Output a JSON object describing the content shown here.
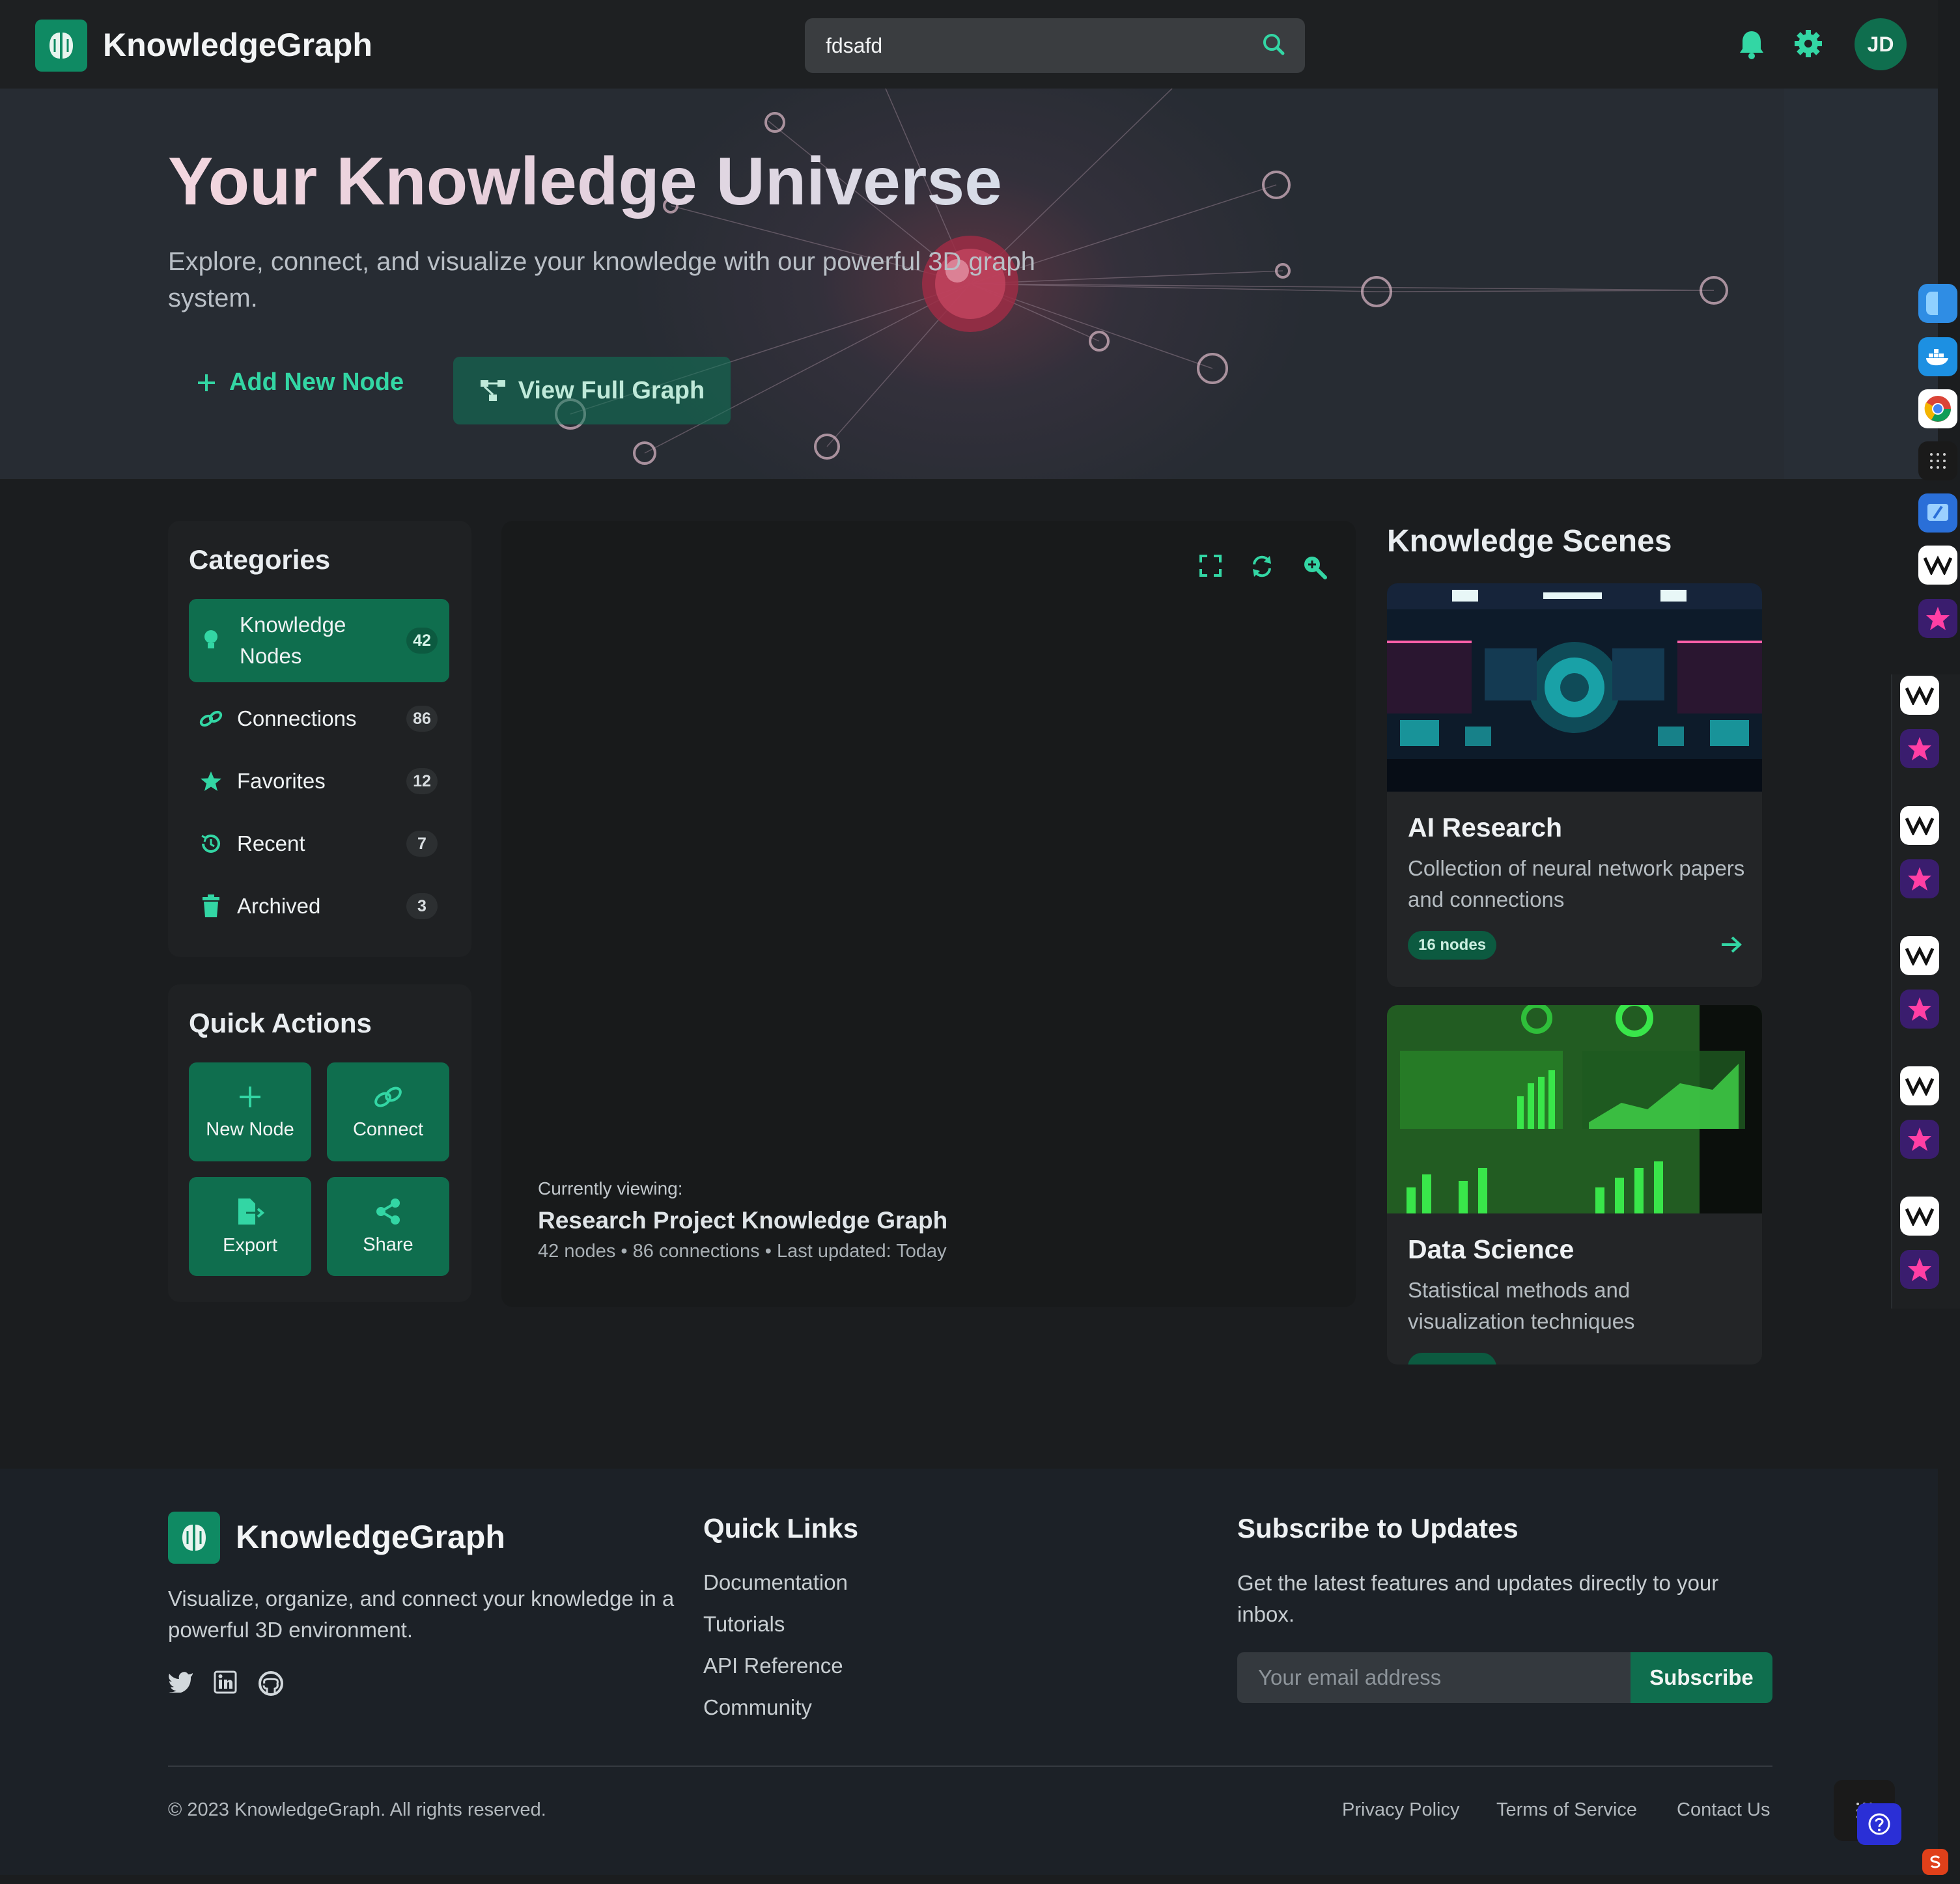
{
  "header": {
    "brand": "KnowledgeGraph",
    "search_value": "fdsafd",
    "avatar_initials": "JD"
  },
  "hero": {
    "title": "Your Knowledge Universe",
    "subtitle": "Explore, connect, and visualize your knowledge with our powerful 3D graph system.",
    "add_node_label": "Add New Node",
    "view_graph_label": "View Full Graph"
  },
  "categories": {
    "title": "Categories",
    "items": [
      {
        "label": "Knowledge Nodes",
        "count": "42",
        "icon": "lightbulb-icon"
      },
      {
        "label": "Connections",
        "count": "86",
        "icon": "link-icon"
      },
      {
        "label": "Favorites",
        "count": "12",
        "icon": "star-icon"
      },
      {
        "label": "Recent",
        "count": "7",
        "icon": "history-icon"
      },
      {
        "label": "Archived",
        "count": "3",
        "icon": "trash-icon"
      }
    ]
  },
  "quick_actions": {
    "title": "Quick Actions",
    "items": [
      {
        "label": "New Node",
        "icon": "plus-icon"
      },
      {
        "label": "Connect",
        "icon": "link-icon"
      },
      {
        "label": "Export",
        "icon": "export-icon"
      },
      {
        "label": "Share",
        "icon": "share-icon"
      }
    ]
  },
  "graph": {
    "currently_viewing_label": "Currently viewing:",
    "title": "Research Project Knowledge Graph",
    "meta": "42 nodes • 86 connections • Last updated: Today"
  },
  "scenes": {
    "title": "Knowledge Scenes",
    "items": [
      {
        "name": "AI Research",
        "description": "Collection of neural network papers and connections",
        "badge": "16 nodes"
      },
      {
        "name": "Data Science",
        "description": "Statistical methods and visualization techniques",
        "badge": ""
      }
    ]
  },
  "footer": {
    "brand": "KnowledgeGraph",
    "description": "Visualize, organize, and connect your knowledge in a powerful 3D environment.",
    "quick_links_title": "Quick Links",
    "quick_links": [
      "Documentation",
      "Tutorials",
      "API Reference",
      "Community"
    ],
    "subscribe_title": "Subscribe to Updates",
    "subscribe_text": "Get the latest features and updates directly to your inbox.",
    "email_placeholder": "Your email address",
    "subscribe_button": "Subscribe",
    "copyright": "© 2023 KnowledgeGraph. All rights reserved.",
    "bottom_links": [
      "Privacy Policy",
      "Terms of Service",
      "Contact Us"
    ]
  },
  "colors": {
    "accent": "#0f6e4e",
    "accent_bright": "#33d6a4",
    "background": "#1b1d1f"
  }
}
